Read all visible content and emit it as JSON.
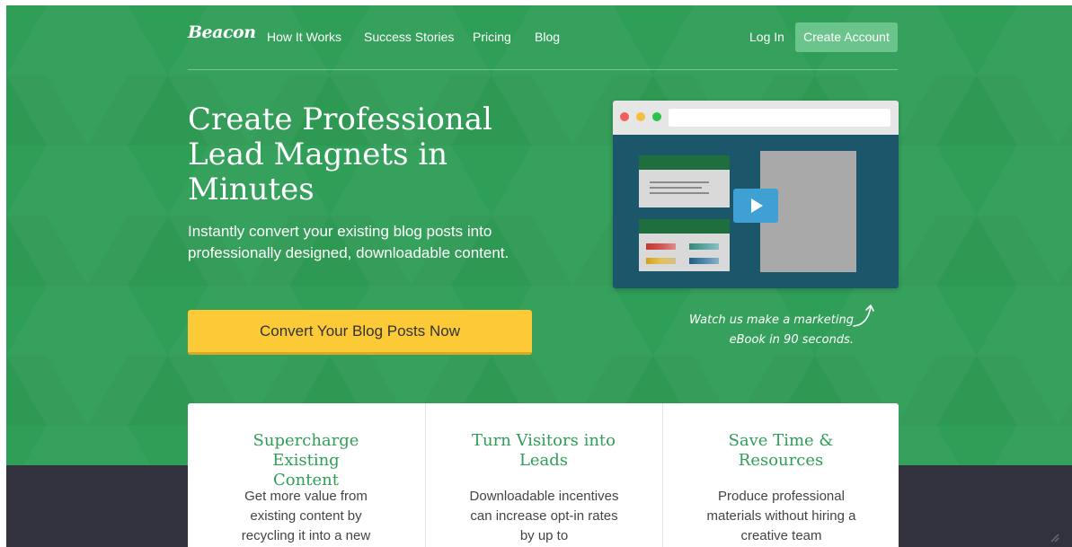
{
  "nav": {
    "logo": "Beacon",
    "links": [
      "How It Works",
      "Success Stories",
      "Pricing",
      "Blog"
    ],
    "login": "Log In",
    "create_account": "Create Account"
  },
  "hero": {
    "title": "Create Professional Lead Magnets in Minutes",
    "subtitle": "Instantly convert your existing blog posts into professionally designed, downloadable content.",
    "cta": "Convert Your Blog Posts Now",
    "video_caption_line1": "Watch us make a marketing",
    "video_caption_line2": "eBook in 90 seconds."
  },
  "features": [
    {
      "title": "Supercharge Existing Content",
      "text": "Get more value from existing content by recycling it into a new"
    },
    {
      "title": "Turn Visitors into Leads",
      "text": "Downloadable incentives can increase opt-in rates by up to"
    },
    {
      "title": "Save Time & Resources",
      "text": "Produce professional materials without hiring a creative team"
    }
  ],
  "colors": {
    "brand_green": "#2f9e56",
    "cta_yellow": "#fcc937",
    "dark_band": "#31323d",
    "video_bg": "#1b566b",
    "play_blue": "#3ea0d3"
  },
  "icons": [
    "play-icon",
    "curved-arrow-icon",
    "window-dot-icon"
  ]
}
